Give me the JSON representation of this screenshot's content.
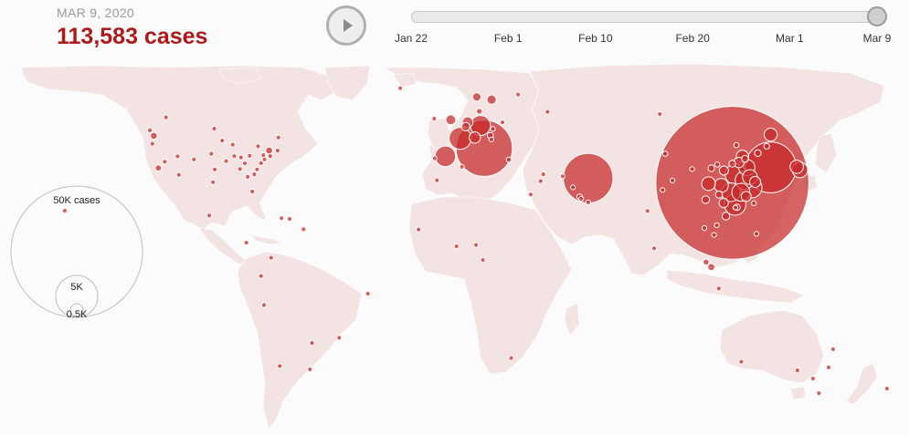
{
  "header": {
    "date": "MAR 9, 2020",
    "cases": "113,583 cases"
  },
  "timeline": {
    "progress": 1.0,
    "ticks": [
      {
        "label": "Jan 22",
        "frac": 0.0
      },
      {
        "label": "Feb 1",
        "frac": 0.2083
      },
      {
        "label": "Feb 10",
        "frac": 0.3958
      },
      {
        "label": "Feb 20",
        "frac": 0.6042
      },
      {
        "label": "Mar 1",
        "frac": 0.8125
      },
      {
        "label": "Mar 9",
        "frac": 1.0
      }
    ]
  },
  "legend": {
    "labels": [
      "50K cases",
      "5K",
      "0.5K"
    ]
  },
  "colors": {
    "bubble": "#c62828",
    "land": "#f3e3e3",
    "accent": "#ad1a1a"
  },
  "bubbles": [
    {
      "place": "Hubei, China",
      "lat": 30.9,
      "lon": 112.3,
      "cases": 67743
    },
    {
      "place": "Italy",
      "lat": 43.0,
      "lon": 12.0,
      "cases": 9172
    },
    {
      "place": "South Korea",
      "lat": 36.3,
      "lon": 127.8,
      "cases": 7478
    },
    {
      "place": "Iran",
      "lat": 32.5,
      "lon": 54.0,
      "cases": 7161
    },
    {
      "place": "France",
      "lat": 46.5,
      "lon": 2.3,
      "cases": 1412
    },
    {
      "place": "Germany",
      "lat": 51.0,
      "lon": 10.5,
      "cases": 1176
    },
    {
      "place": "Spain",
      "lat": 40.2,
      "lon": -3.7,
      "cases": 1231
    },
    {
      "place": "Guangdong",
      "lat": 23.3,
      "lon": 113.4,
      "cases": 1352
    },
    {
      "place": "Henan",
      "lat": 33.9,
      "lon": 113.6,
      "cases": 1272
    },
    {
      "place": "Zhejiang",
      "lat": 29.2,
      "lon": 120.1,
      "cases": 1215
    },
    {
      "place": "Hunan",
      "lat": 27.6,
      "lon": 111.7,
      "cases": 1018
    },
    {
      "place": "Anhui",
      "lat": 31.8,
      "lon": 117.2,
      "cases": 990
    },
    {
      "place": "Jiangxi",
      "lat": 27.6,
      "lon": 115.7,
      "cases": 935
    },
    {
      "place": "Shandong",
      "lat": 36.3,
      "lon": 118.1,
      "cases": 758
    },
    {
      "place": "Diamond Princess",
      "lat": 35.4,
      "lon": 139.6,
      "cases": 696
    },
    {
      "place": "Jiangsu",
      "lat": 32.9,
      "lon": 119.4,
      "cases": 631
    },
    {
      "place": "Chongqing",
      "lat": 30.0,
      "lon": 107.8,
      "cases": 576
    },
    {
      "place": "Sichuan",
      "lat": 30.6,
      "lon": 102.7,
      "cases": 539
    },
    {
      "place": "Japan",
      "lat": 36.5,
      "lon": 138.3,
      "cases": 511
    },
    {
      "place": "Heilongjiang",
      "lat": 47.8,
      "lon": 127.8,
      "cases": 481
    },
    {
      "place": "Switzerland",
      "lat": 46.8,
      "lon": 8.2,
      "cases": 374
    },
    {
      "place": "Netherlands",
      "lat": 52.2,
      "lon": 5.3,
      "cases": 321
    },
    {
      "place": "United Kingdom",
      "lat": 53.0,
      "lon": -1.5,
      "cases": 278
    },
    {
      "place": "Sweden",
      "lat": 60.1,
      "lon": 15.0,
      "cases": 248
    },
    {
      "place": "Norway",
      "lat": 61.0,
      "lon": 9.0,
      "cases": 205
    },
    {
      "place": "Belgium",
      "lat": 50.6,
      "lon": 4.5,
      "cases": 200
    },
    {
      "place": "Beijing",
      "lat": 40.2,
      "lon": 116.4,
      "cases": 428
    },
    {
      "place": "Shanghai",
      "lat": 31.2,
      "lon": 121.5,
      "cases": 342
    },
    {
      "place": "Hebei",
      "lat": 38.0,
      "lon": 114.9,
      "cases": 318
    },
    {
      "place": "Fujian",
      "lat": 26.1,
      "lon": 117.9,
      "cases": 296
    },
    {
      "place": "Guangxi",
      "lat": 23.8,
      "lon": 108.8,
      "cases": 252
    },
    {
      "place": "Shaanxi",
      "lat": 35.2,
      "lon": 108.9,
      "cases": 245
    },
    {
      "place": "Yunnan",
      "lat": 25.0,
      "lon": 101.5,
      "cases": 174
    },
    {
      "place": "Hainan",
      "lat": 19.2,
      "lon": 109.7,
      "cases": 168
    },
    {
      "place": "Guizhou",
      "lat": 26.8,
      "lon": 106.9,
      "cases": 146
    },
    {
      "place": "Tianjin",
      "lat": 39.3,
      "lon": 117.4,
      "cases": 136
    },
    {
      "place": "Shanxi",
      "lat": 37.6,
      "lon": 112.3,
      "cases": 133
    },
    {
      "place": "Liaoning",
      "lat": 41.3,
      "lon": 122.6,
      "cases": 125
    },
    {
      "place": "Hong Kong",
      "lat": 22.3,
      "lon": 114.2,
      "cases": 115
    },
    {
      "place": "Jilin",
      "lat": 43.7,
      "lon": 126.2,
      "cases": 93
    },
    {
      "place": "Gansu",
      "lat": 36.0,
      "lon": 103.8,
      "cases": 125
    },
    {
      "place": "Xinjiang",
      "lat": 41.1,
      "lon": 85.2,
      "cases": 76
    },
    {
      "place": "Inner Mongolia",
      "lat": 44.1,
      "lon": 113.9,
      "cases": 75
    },
    {
      "place": "Ningxia",
      "lat": 37.3,
      "lon": 106.2,
      "cases": 75
    },
    {
      "place": "Taiwan",
      "lat": 23.7,
      "lon": 121.0,
      "cases": 45
    },
    {
      "place": "Qinghai",
      "lat": 35.7,
      "lon": 96.0,
      "cases": 18
    },
    {
      "place": "Macau",
      "lat": 22.2,
      "lon": 113.5,
      "cases": 10
    },
    {
      "place": "Tibet",
      "lat": 31.7,
      "lon": 88.1,
      "cases": 1
    },
    {
      "place": "Singapore",
      "lat": 1.3,
      "lon": 103.8,
      "cases": 150
    },
    {
      "place": "Malaysia",
      "lat": 3.1,
      "lon": 101.7,
      "cases": 99
    },
    {
      "place": "Bahrain",
      "lat": 26.0,
      "lon": 50.6,
      "cases": 95
    },
    {
      "place": "Kuwait",
      "lat": 29.3,
      "lon": 47.9,
      "cases": 64
    },
    {
      "place": "Austria",
      "lat": 47.5,
      "lon": 14.5,
      "cases": 112
    },
    {
      "place": "Iceland",
      "lat": 64.1,
      "lon": -21.9,
      "cases": 58
    },
    {
      "place": "Greece",
      "lat": 39.0,
      "lon": 22.0,
      "cases": 73
    },
    {
      "place": "Israel",
      "lat": 31.5,
      "lon": 34.8,
      "cases": 39
    },
    {
      "place": "Denmark",
      "lat": 56.0,
      "lon": 10.0,
      "cases": 90
    },
    {
      "place": "Finland",
      "lat": 61.9,
      "lon": 25.7,
      "cases": 30
    },
    {
      "place": "Czechia",
      "lat": 49.8,
      "lon": 15.5,
      "cases": 31
    },
    {
      "place": "Slovenia",
      "lat": 46.1,
      "lon": 14.9,
      "cases": 25
    },
    {
      "place": "Egypt",
      "lat": 26.8,
      "lon": 30.8,
      "cases": 55
    },
    {
      "place": "Iraq",
      "lat": 33.2,
      "lon": 43.7,
      "cases": 60
    },
    {
      "place": "Lebanon",
      "lat": 33.9,
      "lon": 35.9,
      "cases": 32
    },
    {
      "place": "UAE",
      "lat": 24.0,
      "lon": 54.0,
      "cases": 45
    },
    {
      "place": "Qatar",
      "lat": 25.3,
      "lon": 51.2,
      "cases": 15
    },
    {
      "place": "India",
      "lat": 21.0,
      "lon": 78.0,
      "cases": 43
    },
    {
      "place": "Thailand",
      "lat": 15.0,
      "lon": 101.0,
      "cases": 50
    },
    {
      "place": "Vietnam",
      "lat": 16.0,
      "lon": 106.0,
      "cases": 30
    },
    {
      "place": "Philippines",
      "lat": 13.0,
      "lon": 122.0,
      "cases": 20
    },
    {
      "place": "Indonesia",
      "lat": -6.2,
      "lon": 106.8,
      "cases": 19
    },
    {
      "place": "Sri Lanka",
      "lat": 7.9,
      "lon": 80.7,
      "cases": 1
    },
    {
      "place": "Nepal",
      "lat": 28.4,
      "lon": 84.1,
      "cases": 1
    },
    {
      "place": "Cambodia",
      "lat": 12.6,
      "lon": 104.9,
      "cases": 2
    },
    {
      "place": "Russia",
      "lat": 55.8,
      "lon": 37.6,
      "cases": 17
    },
    {
      "place": "Novosibirsk",
      "lat": 55.0,
      "lon": 83.0,
      "cases": 1
    },
    {
      "place": "Poland",
      "lat": 52.1,
      "lon": 19.4,
      "cases": 11
    },
    {
      "place": "Portugal",
      "lat": 39.5,
      "lon": -8.0,
      "cases": 30
    },
    {
      "place": "Ireland",
      "lat": 53.4,
      "lon": -8.2,
      "cases": 21
    },
    {
      "place": "Algeria",
      "lat": 36.5,
      "lon": 3.0,
      "cases": 20
    },
    {
      "place": "Morocco",
      "lat": 31.8,
      "lon": -7.1,
      "cases": 2
    },
    {
      "place": "Senegal",
      "lat": 14.5,
      "lon": -14.5,
      "cases": 4
    },
    {
      "place": "Nigeria",
      "lat": 9.1,
      "lon": 8.7,
      "cases": 2
    },
    {
      "place": "Cameroon",
      "lat": 3.8,
      "lon": 11.5,
      "cases": 2
    },
    {
      "place": "Togo",
      "lat": 8.6,
      "lon": 0.8,
      "cases": 1
    },
    {
      "place": "South Africa",
      "lat": -30.6,
      "lon": 22.9,
      "cases": 7
    },
    {
      "place": "Australia NSW",
      "lat": -33.9,
      "lon": 151.2,
      "cases": 40
    },
    {
      "place": "Australia VIC",
      "lat": -37.8,
      "lon": 144.9,
      "cases": 15
    },
    {
      "place": "Australia QLD",
      "lat": -27.5,
      "lon": 153.0,
      "cases": 15
    },
    {
      "place": "Australia WA",
      "lat": -31.9,
      "lon": 115.9,
      "cases": 3
    },
    {
      "place": "Australia SA",
      "lat": -34.9,
      "lon": 138.6,
      "cases": 7
    },
    {
      "place": "Australia TAS",
      "lat": -42.9,
      "lon": 147.3,
      "cases": 2
    },
    {
      "place": "New Zealand",
      "lat": -41.3,
      "lon": 174.8,
      "cases": 5
    },
    {
      "place": "Washington",
      "lat": 47.4,
      "lon": -121.5,
      "cases": 136
    },
    {
      "place": "California",
      "lat": 36.1,
      "lon": -119.7,
      "cases": 114
    },
    {
      "place": "New York",
      "lat": 42.2,
      "lon": -74.9,
      "cases": 142
    },
    {
      "place": "Massachusetts",
      "lat": 42.2,
      "lon": -71.5,
      "cases": 41
    },
    {
      "place": "Oregon",
      "lat": 44.6,
      "lon": -122.1,
      "cases": 14
    },
    {
      "place": "Texas",
      "lat": 31.1,
      "lon": -97.6,
      "cases": 13
    },
    {
      "place": "Illinois",
      "lat": 40.3,
      "lon": -89.0,
      "cases": 7
    },
    {
      "place": "Florida",
      "lat": 27.8,
      "lon": -81.7,
      "cases": 14
    },
    {
      "place": "Colorado",
      "lat": 39.1,
      "lon": -105.3,
      "cases": 8
    },
    {
      "place": "Georgia",
      "lat": 33.0,
      "lon": -83.6,
      "cases": 7
    },
    {
      "place": "New Jersey",
      "lat": 40.3,
      "lon": -74.5,
      "cases": 6
    },
    {
      "place": "Pennsylvania",
      "lat": 40.6,
      "lon": -77.2,
      "cases": 7
    },
    {
      "place": "Maryland",
      "lat": 39.1,
      "lon": -76.8,
      "cases": 5
    },
    {
      "place": "Tennessee",
      "lat": 35.7,
      "lon": -86.7,
      "cases": 3
    },
    {
      "place": "Nevada",
      "lat": 38.3,
      "lon": -117.1,
      "cases": 4
    },
    {
      "place": "Arizona",
      "lat": 33.7,
      "lon": -111.4,
      "cases": 5
    },
    {
      "place": "North Carolina",
      "lat": 35.6,
      "lon": -79.8,
      "cases": 2
    },
    {
      "place": "Minnesota",
      "lat": 45.7,
      "lon": -93.9,
      "cases": 2
    },
    {
      "place": "Indiana",
      "lat": 39.8,
      "lon": -86.3,
      "cases": 4
    },
    {
      "place": "Kentucky",
      "lat": 37.7,
      "lon": -84.7,
      "cases": 4
    },
    {
      "place": "Utah",
      "lat": 40.2,
      "lon": -111.9,
      "cases": 1
    },
    {
      "place": "Oklahoma",
      "lat": 35.6,
      "lon": -96.9,
      "cases": 1
    },
    {
      "place": "Nebraska",
      "lat": 41.1,
      "lon": -98.3,
      "cases": 3
    },
    {
      "place": "Wisconsin",
      "lat": 44.3,
      "lon": -89.6,
      "cases": 1
    },
    {
      "place": "Missouri",
      "lat": 38.5,
      "lon": -92.3,
      "cases": 1
    },
    {
      "place": "Ohio",
      "lat": 40.4,
      "lon": -82.8,
      "cases": 3
    },
    {
      "place": "Virginia",
      "lat": 37.8,
      "lon": -78.2,
      "cases": 2
    },
    {
      "place": "South Carolina",
      "lat": 33.9,
      "lon": -80.9,
      "cases": 2
    },
    {
      "place": "Hawaii",
      "lat": 21.1,
      "lon": -157.5,
      "cases": 2
    },
    {
      "place": "Ontario",
      "lat": 43.7,
      "lon": -79.4,
      "cases": 34
    },
    {
      "place": "British Columbia",
      "lat": 49.3,
      "lon": -123.1,
      "cases": 32
    },
    {
      "place": "Quebec",
      "lat": 46.8,
      "lon": -71.2,
      "cases": 4
    },
    {
      "place": "Alberta",
      "lat": 53.9,
      "lon": -116.6,
      "cases": 1
    },
    {
      "place": "Manitoba",
      "lat": 49.9,
      "lon": -97.1,
      "cases": 1
    },
    {
      "place": "Mexico",
      "lat": 19.4,
      "lon": -99.1,
      "cases": 7
    },
    {
      "place": "Dominican Republic",
      "lat": 18.5,
      "lon": -69.9,
      "cases": 5
    },
    {
      "place": "Martinique",
      "lat": 14.6,
      "lon": -61.0,
      "cases": 2
    },
    {
      "place": "Costa Rica",
      "lat": 9.9,
      "lon": -84.1,
      "cases": 9
    },
    {
      "place": "Colombia",
      "lat": 4.6,
      "lon": -74.1,
      "cases": 1
    },
    {
      "place": "Ecuador",
      "lat": -1.8,
      "lon": -78.2,
      "cases": 15
    },
    {
      "place": "Peru",
      "lat": -12.0,
      "lon": -77.0,
      "cases": 7
    },
    {
      "place": "Brazil",
      "lat": -23.5,
      "lon": -46.6,
      "cases": 25
    },
    {
      "place": "Brazil North",
      "lat": -8.0,
      "lon": -35.0,
      "cases": 2
    },
    {
      "place": "Paraguay",
      "lat": -25.3,
      "lon": -57.6,
      "cases": 1
    },
    {
      "place": "Chile",
      "lat": -33.4,
      "lon": -70.6,
      "cases": 8
    },
    {
      "place": "Argentina",
      "lat": -34.6,
      "lon": -58.4,
      "cases": 12
    },
    {
      "place": "Puerto Rico",
      "lat": 18.2,
      "lon": -66.6,
      "cases": 3
    }
  ]
}
